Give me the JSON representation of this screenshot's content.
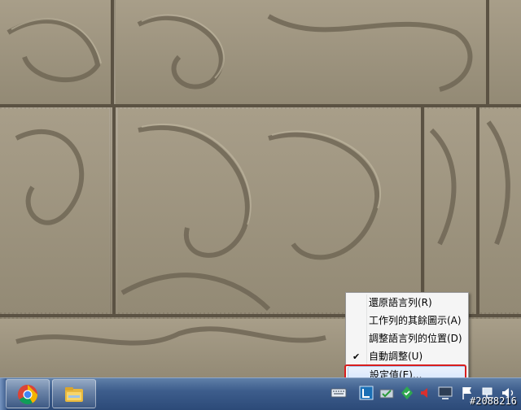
{
  "context_menu": {
    "items": [
      {
        "label": "還原語言列(R)",
        "checked": false
      },
      {
        "label": "工作列的其餘圖示(A)",
        "checked": false
      },
      {
        "label": "調整語言列的位置(D)",
        "checked": false
      },
      {
        "label": "自動調整(U)",
        "checked": true
      },
      {
        "label": "設定值(E)...",
        "checked": false,
        "highlighted": true
      }
    ],
    "check_mark": "✔"
  },
  "taskbar": {
    "pinned": [
      {
        "name": "chrome-icon"
      },
      {
        "name": "folder-icon"
      }
    ],
    "tray": [
      "keyboard-icon",
      "language-bar-icon",
      "network-monitor-icon",
      "sync-icon",
      "volume-icon",
      "display-icon",
      "flag-icon",
      "network-icon",
      "speaker-icon"
    ]
  },
  "watermark": "#2088216",
  "colors": {
    "highlight_box": "#d81e1e",
    "menu_background": "#f5f5f5"
  }
}
